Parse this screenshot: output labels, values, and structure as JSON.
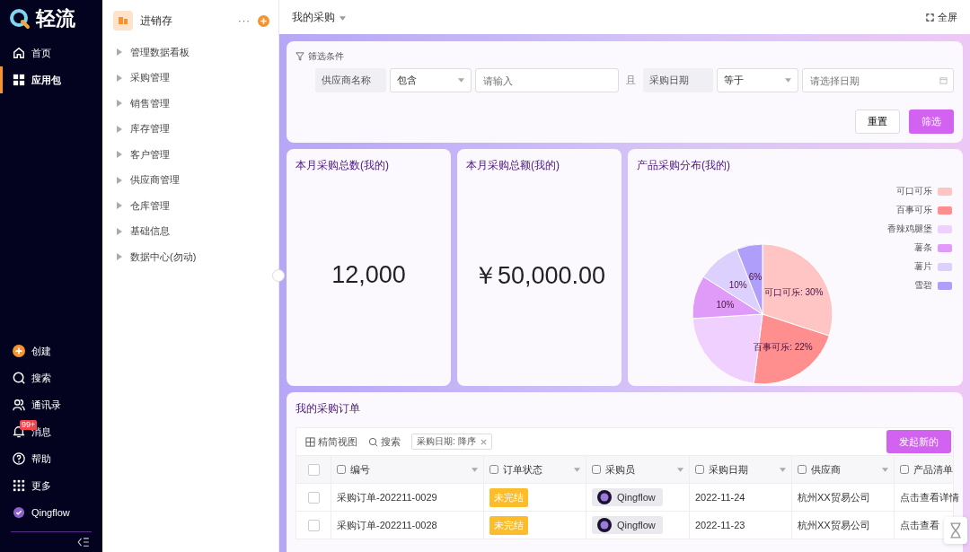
{
  "brand": {
    "name": "轻流"
  },
  "nav_top": [
    {
      "label": "首页",
      "selected": false
    },
    {
      "label": "应用包",
      "selected": true
    }
  ],
  "nav_bottom": [
    {
      "label": "创建"
    },
    {
      "label": "搜索"
    },
    {
      "label": "通讯录"
    },
    {
      "label": "消息",
      "badge": "99+"
    },
    {
      "label": "帮助"
    },
    {
      "label": "更多"
    },
    {
      "label": "Qingflow"
    }
  ],
  "app": {
    "name": "进销存",
    "more": "···"
  },
  "tree": [
    {
      "label": "管理数据看板",
      "expanded": false
    },
    {
      "label": "采购管理",
      "expanded": false
    },
    {
      "label": "销售管理",
      "expanded": false
    },
    {
      "label": "库存管理",
      "expanded": false
    },
    {
      "label": "客户管理",
      "expanded": false
    },
    {
      "label": "供应商管理",
      "expanded": false
    },
    {
      "label": "仓库管理",
      "expanded": false
    },
    {
      "label": "基础信息",
      "expanded": false
    },
    {
      "label": "数据中心(勿动)",
      "expanded": false
    }
  ],
  "header": {
    "title": "我的采购",
    "fullscreen": "全屏"
  },
  "filter": {
    "title": "筛选条件",
    "conditions": [
      {
        "field": "供应商名称",
        "operator": "包含",
        "placeholder": "请输入",
        "kind": "text"
      },
      {
        "field": "采购日期",
        "operator": "等于",
        "placeholder": "请选择日期",
        "kind": "date"
      }
    ],
    "joiner": "且",
    "buttons": [
      "重置",
      "筛选"
    ]
  },
  "kpis": [
    {
      "title": "本月采购总数(我的)",
      "value": "12,000"
    },
    {
      "title": "本月采购总额(我的)",
      "value": "￥50,000.00"
    }
  ],
  "pie": {
    "title": "产品采购分布(我的)",
    "chart_data": {
      "type": "pie",
      "categories": [
        "可口可乐",
        "百事可乐",
        "香辣鸡腿堡",
        "薯条",
        "薯片",
        "雪碧"
      ],
      "values": [
        30,
        22,
        22,
        10,
        10,
        6
      ],
      "colors": [
        "#ffc5c5",
        "#ff8e8e",
        "#f0d0fe",
        "#e09bf9",
        "#dcd0fe",
        "#b09efb"
      ],
      "value_labels": [
        "可口可乐: 30%",
        "百事可乐: 22%",
        null,
        "10%",
        "10%",
        "6%"
      ]
    }
  },
  "orders": {
    "title": "我的采购订单",
    "view": "精简视图",
    "search": "搜索",
    "sort_tag": "采购日期: 降序",
    "new_button": "发起新的",
    "columns": [
      "编号",
      "订单状态",
      "采购员",
      "采购日期",
      "供应商",
      "产品清单"
    ],
    "header_checked": false,
    "rows": [
      {
        "checked": false,
        "number": "采购订单-202211-0029",
        "status": "未完结",
        "buyer": "Qingflow",
        "date": "2022-11-24",
        "supplier": "杭州XX贸易公司",
        "detail": "点击查看详情"
      },
      {
        "checked": false,
        "number": "采购订单-202211-0028",
        "status": "未完结",
        "buyer": "Qingflow",
        "date": "2022-11-23",
        "supplier": "杭州XX贸易公司",
        "detail": "点击查看"
      }
    ]
  }
}
